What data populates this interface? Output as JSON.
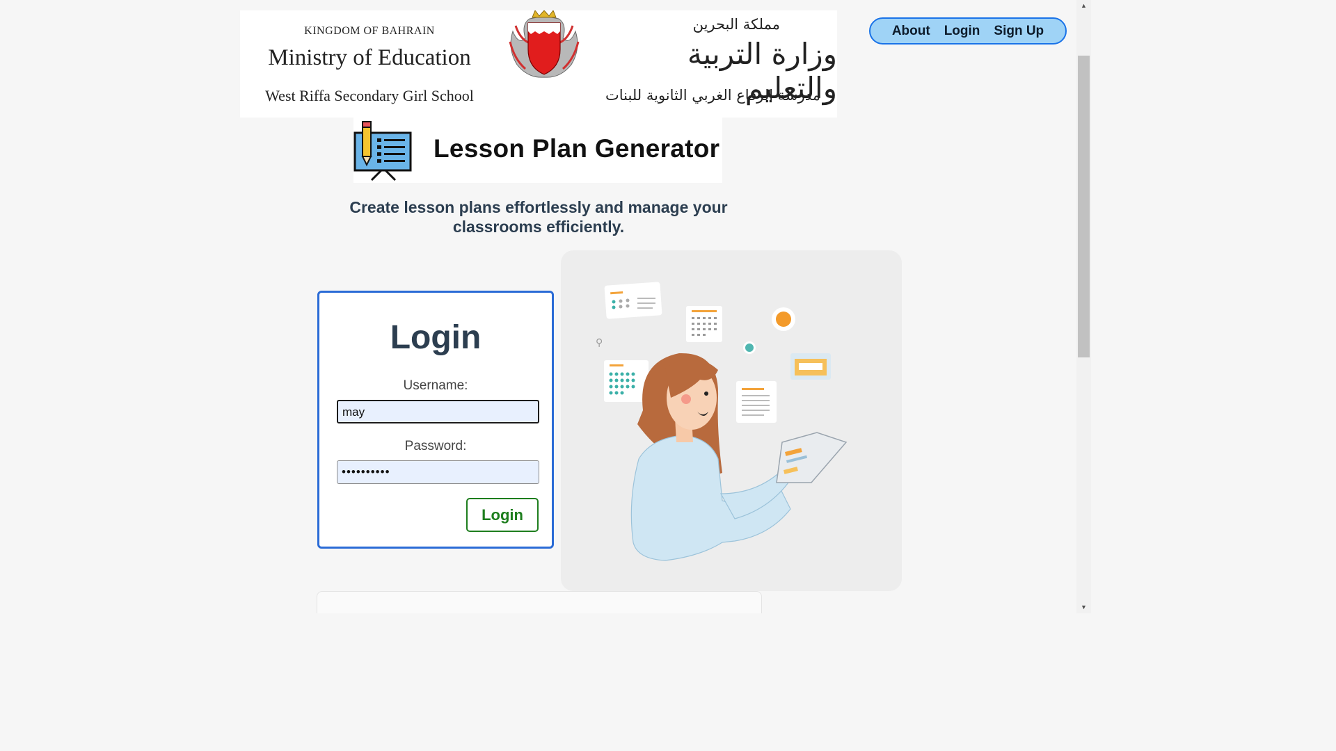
{
  "banner": {
    "kingdom_en": "KINGDOM OF BAHRAIN",
    "ministry_en": "Ministry of Education",
    "school_en": "West Riffa Secondary Girl School",
    "kingdom_ar": "مملكة البحرين",
    "ministry_ar": "وزارة التربية والتعليم",
    "school_ar": "مدرسة الرفاع الغربي الثانوية للبنات"
  },
  "nav": {
    "about": "About",
    "login": "Login",
    "signup": "Sign Up"
  },
  "app_title": "Lesson Plan Generator",
  "tagline": "Create lesson plans effortlessly and manage your classrooms efficiently.",
  "login_form": {
    "title": "Login",
    "username_label": "Username:",
    "username_value": "may",
    "password_label": "Password:",
    "password_value": "••••••••••",
    "submit_label": "Login"
  },
  "colors": {
    "nav_bg": "#9fd3f6",
    "nav_border": "#1a73e8",
    "card_border": "#2a6bd6",
    "login_button": "#1e7e1e",
    "heading": "#2c3e50"
  }
}
